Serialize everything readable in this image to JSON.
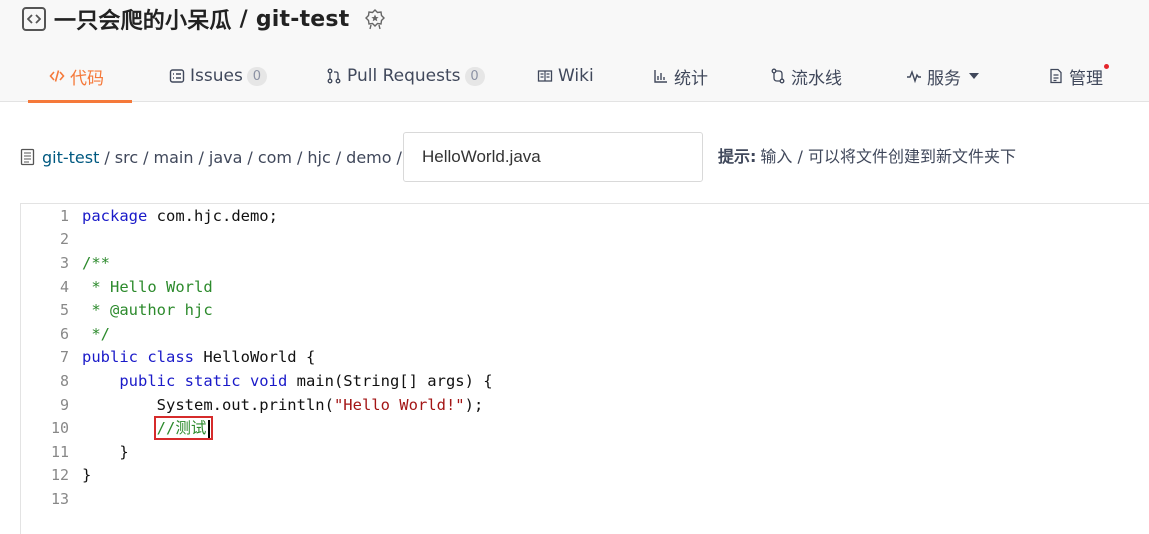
{
  "repo": {
    "owner": "一只会爬的小呆瓜",
    "separator": "/",
    "name": "git-test"
  },
  "tabs": [
    {
      "label": "代码",
      "icon": "code-icon",
      "active": true
    },
    {
      "label": "Issues",
      "icon": "issues-icon",
      "count": "0"
    },
    {
      "label": "Pull Requests",
      "icon": "pull-request-icon",
      "count": "0"
    },
    {
      "label": "Wiki",
      "icon": "wiki-icon"
    },
    {
      "label": "统计",
      "icon": "stats-icon"
    },
    {
      "label": "流水线",
      "icon": "pipeline-icon"
    },
    {
      "label": "服务",
      "icon": "service-icon",
      "dropdown": true
    },
    {
      "label": "管理",
      "icon": "manage-icon",
      "notification_dot": true
    }
  ],
  "path": {
    "crumbs": [
      "git-test",
      "src",
      "main",
      "java",
      "com",
      "hjc",
      "demo"
    ],
    "filename": "HelloWorld.java",
    "hint_label": "提示:",
    "hint_text": "输入 / 可以将文件创建到新文件夹下"
  },
  "editor": {
    "line_numbers": [
      "1",
      "2",
      "3",
      "4",
      "5",
      "6",
      "7",
      "8",
      "9",
      "10",
      "11",
      "12",
      "13"
    ],
    "lines": {
      "l1_kw": "package",
      "l1_rest": " com.hjc.demo;",
      "l3": "/**",
      "l4": " * Hello World",
      "l5": " * @author hjc",
      "l6": " */",
      "l7_kw": "public class",
      "l7_rest": " HelloWorld {",
      "l8_indent": "    ",
      "l8_kw": "public static void",
      "l8_rest": " main(String[] args) {",
      "l9_indent": "        ",
      "l9_pre": "System.out.println(",
      "l9_str": "\"Hello World!\"",
      "l9_post": ");",
      "l10_indent": "        ",
      "l10_comment": "//测试",
      "l11": "    }",
      "l12": "}"
    }
  },
  "colors": {
    "accent": "#f5793a",
    "link": "#005980",
    "keyword": "#1a1ac9",
    "comment": "#2c8a2c",
    "string": "#a31515",
    "highlight_box": "#d62b2b"
  }
}
